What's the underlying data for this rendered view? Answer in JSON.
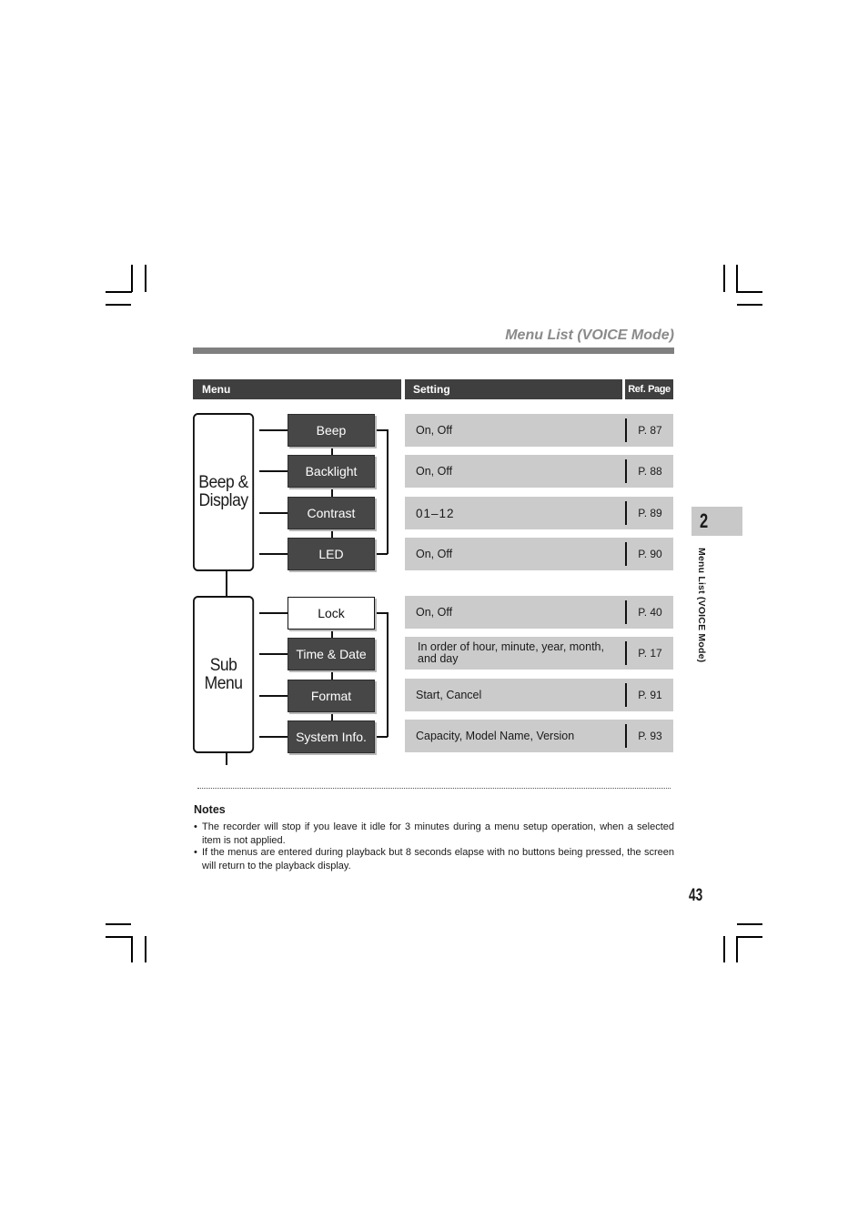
{
  "page": {
    "section_title": "Menu List (VOICE Mode)",
    "chapter_number": "2",
    "side_label": "Menu List (VOICE Mode)",
    "page_number": "43"
  },
  "table_header": {
    "menu": "Menu",
    "setting": "Setting",
    "ref_page": "Ref. Page"
  },
  "groups": [
    {
      "label_line1": "Beep &",
      "label_line2": "Display",
      "items": [
        {
          "label": "Beep",
          "setting": "On, Off",
          "ref": "P. 87",
          "style": "dark"
        },
        {
          "label": "Backlight",
          "setting": "On, Off",
          "ref": "P. 88",
          "style": "dark"
        },
        {
          "label": "Contrast",
          "setting": "01–12",
          "ref": "P. 89",
          "style": "dark"
        },
        {
          "label": "LED",
          "setting": "On, Off",
          "ref": "P. 90",
          "style": "dark"
        }
      ]
    },
    {
      "label_line1": "Sub",
      "label_line2": "Menu",
      "items": [
        {
          "label": "Lock",
          "setting": "On, Off",
          "ref": "P. 40",
          "style": "light"
        },
        {
          "label": "Time & Date",
          "setting": "In order of hour, minute, year, month, and day",
          "ref": "P. 17",
          "style": "dark"
        },
        {
          "label": "Format",
          "setting": "Start, Cancel",
          "ref": "P. 91",
          "style": "dark"
        },
        {
          "label": "System Info.",
          "setting": "Capacity, Model Name, Version",
          "ref": "P. 93",
          "style": "dark"
        }
      ]
    }
  ],
  "notes": {
    "heading": "Notes",
    "bullet": "•",
    "items": [
      "The recorder will stop if you leave it idle for 3 minutes during a menu setup operation, when a selected item is not applied.",
      "If the menus are entered during playback but 8 seconds elapse with no buttons being pressed, the screen will return to the playback display."
    ]
  }
}
